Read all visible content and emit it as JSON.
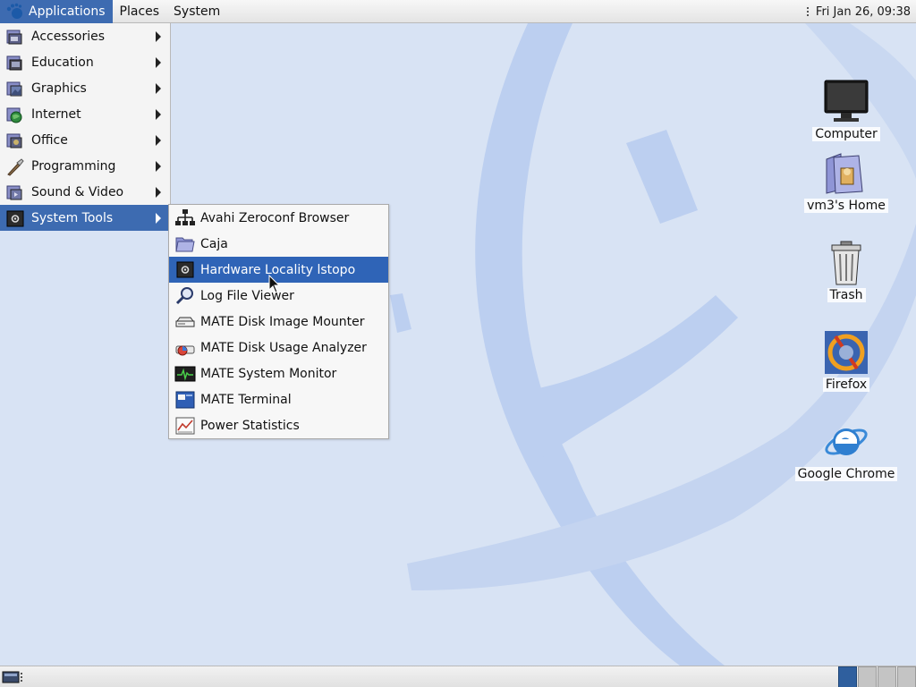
{
  "top_panel": {
    "menus": [
      {
        "label": "Applications",
        "active": true
      },
      {
        "label": "Places"
      },
      {
        "label": "System"
      }
    ],
    "clock": "Fri Jan 26, 09:38"
  },
  "applications_menu": {
    "items": [
      {
        "label": "Accessories",
        "icon": "accessories-icon"
      },
      {
        "label": "Education",
        "icon": "education-icon"
      },
      {
        "label": "Graphics",
        "icon": "graphics-icon"
      },
      {
        "label": "Internet",
        "icon": "internet-icon"
      },
      {
        "label": "Office",
        "icon": "office-icon"
      },
      {
        "label": "Programming",
        "icon": "programming-icon"
      },
      {
        "label": "Sound & Video",
        "icon": "sound-video-icon"
      },
      {
        "label": "System Tools",
        "icon": "system-tools-icon",
        "active": true
      }
    ]
  },
  "system_tools_menu": {
    "items": [
      {
        "label": "Avahi Zeroconf Browser",
        "icon": "network-icon"
      },
      {
        "label": "Caja",
        "icon": "folder-icon"
      },
      {
        "label": "Hardware Locality lstopo",
        "icon": "gear-icon",
        "active": true
      },
      {
        "label": "Log File Viewer",
        "icon": "magnifier-icon"
      },
      {
        "label": "MATE Disk Image Mounter",
        "icon": "disk-drive-icon"
      },
      {
        "label": "MATE Disk Usage Analyzer",
        "icon": "disk-usage-icon"
      },
      {
        "label": "MATE System Monitor",
        "icon": "system-monitor-icon"
      },
      {
        "label": "MATE Terminal",
        "icon": "terminal-icon"
      },
      {
        "label": "Power Statistics",
        "icon": "power-statistics-icon"
      }
    ]
  },
  "desktop": {
    "icons": [
      {
        "label": "Computer",
        "icon": "computer-icon"
      },
      {
        "label": "vm3's Home",
        "icon": "home-folder-icon"
      },
      {
        "label": "Trash",
        "icon": "trash-icon"
      },
      {
        "label": "Firefox",
        "icon": "firefox-icon"
      },
      {
        "label": "Google Chrome",
        "icon": "chrome-icon"
      }
    ]
  },
  "colors": {
    "menu_highlight": "#3d6bb1",
    "desktop_background": "#d6e1f3"
  }
}
